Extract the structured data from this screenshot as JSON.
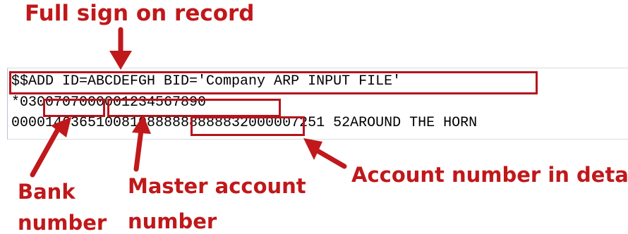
{
  "callouts": {
    "full_sign": "Full sign on record",
    "bank_number_line1": "Bank",
    "bank_number_line2": "number",
    "master_account_line1": "Master account",
    "master_account_line2": "number",
    "account_number_detail": "Account number in detail"
  },
  "record": {
    "lines": [
      "$$ADD ID=ABCDEFGH BID='Company ARP INPUT FILE'",
      "*0300707000001234567890",
      "0000146365100810888888888832000007251 52AROUND THE HORN"
    ]
  },
  "colors": {
    "annotation_red": "#c0181b",
    "box_red": "#b5141c",
    "record_text": "#000000"
  }
}
